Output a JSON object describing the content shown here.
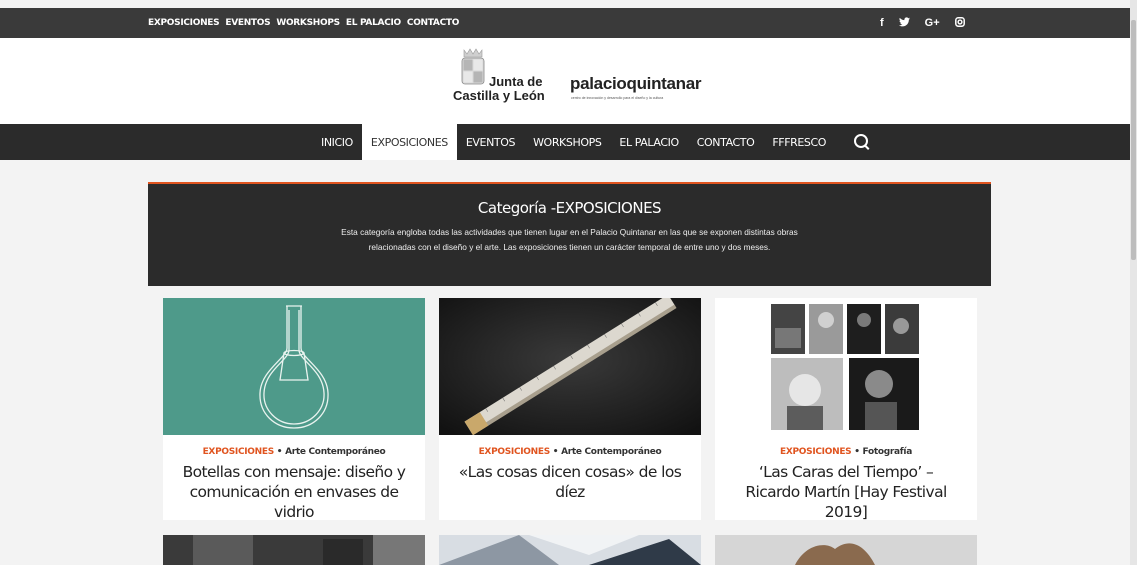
{
  "topbar": {
    "links": [
      "EXPOSICIONES",
      "EVENTOS",
      "WORKSHOPS",
      "EL PALACIO",
      "CONTACTO"
    ],
    "social": [
      "f",
      "♥",
      "G+",
      "◎"
    ]
  },
  "header": {
    "jcyl_line1": "Junta de",
    "jcyl_line2": "Castilla y León",
    "brand": "palacioquintanar",
    "brand_sub": "centro de innovación y desarrollo para el diseño y la cultura"
  },
  "nav": {
    "items": [
      "INICIO",
      "EXPOSICIONES",
      "EVENTOS",
      "WORKSHOPS",
      "EL PALACIO",
      "CONTACTO",
      "FFFRESCO"
    ],
    "active": "EXPOSICIONES"
  },
  "category": {
    "title": "Categoría -EXPOSICIONES",
    "description": "Esta categoría engloba todas las actividades que tienen lugar en el Palacio Quintanar en las que se exponen distintas obras relacionadas con el diseño y el arte. Las exposiciones tienen un carácter temporal de entre uno y dos meses."
  },
  "cards": [
    {
      "category": "EXPOSICIONES",
      "subcategory": "Arte Contemporáneo",
      "title": "Botellas con mensaje: diseño y comunicación en envases de vidrio"
    },
    {
      "category": "EXPOSICIONES",
      "subcategory": "Arte Contemporáneo",
      "title": "«Las cosas dicen cosas» de los díez"
    },
    {
      "category": "EXPOSICIONES",
      "subcategory": "Fotografía",
      "title": "‘Las Caras del Tiempo’ – Ricardo Martín [Hay Festival 2019]"
    }
  ],
  "colors": {
    "accent": "#e0541f",
    "dark": "#2b2b2b",
    "teal": "#4e9a8a"
  }
}
